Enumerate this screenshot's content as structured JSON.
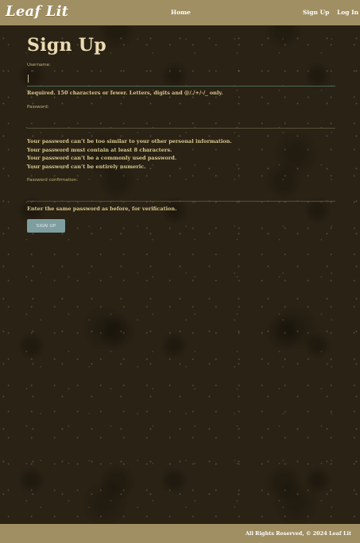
{
  "header": {
    "logo": "Leaf Lit",
    "nav": {
      "home": "Home",
      "signup": "Sign Up",
      "login": "Log In"
    }
  },
  "form": {
    "title": "Sign Up",
    "username": {
      "label": "Username:",
      "value": "",
      "help": "Required. 150 characters or fewer. Letters, digits and @/./+/-/_ only."
    },
    "password": {
      "label": "Password:",
      "value": "",
      "requirements": [
        "Your password can’t be too similar to your other personal information.",
        "Your password must contain at least 8 characters.",
        "Your password can’t be a commonly used password.",
        "Your password can’t be entirely numeric."
      ]
    },
    "password_confirmation": {
      "label": "Password confirmation:",
      "value": "",
      "help": "Enter the same password as before, for verification."
    },
    "submit_label": "SIGN UP"
  },
  "footer": {
    "text": "All Rights Reserved, © 2024 Leaf Lit"
  },
  "colors": {
    "header_bg": "#a08f63",
    "page_bg": "#2a2214",
    "text_gold": "#d9c88d",
    "button_bg": "#7f9ea0"
  }
}
